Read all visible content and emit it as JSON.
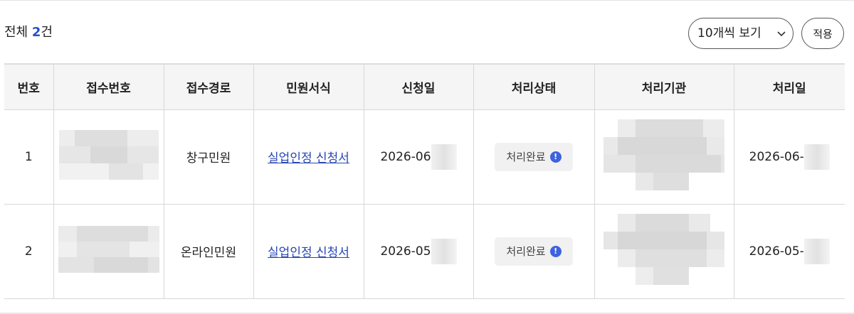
{
  "summary": {
    "prefix": "전체",
    "count": "2",
    "suffix": "건"
  },
  "controls": {
    "page_size_label": "10개씩 보기",
    "apply_label": "적용"
  },
  "table": {
    "headers": [
      "번호",
      "접수번호",
      "접수경로",
      "민원서식",
      "신청일",
      "처리상태",
      "처리기관",
      "처리일"
    ],
    "rows": [
      {
        "no": "1",
        "route": "창구민원",
        "form": "실업인정 신청서",
        "applied": "2026-06",
        "status": "처리완료",
        "processed": "2026-06-"
      },
      {
        "no": "2",
        "route": "온라인민원",
        "form": "실업인정 신청서",
        "applied": "2026-05",
        "status": "처리완료",
        "processed": "2026-05-"
      }
    ]
  },
  "colors": {
    "accent": "#2552c9",
    "link": "#2746b5",
    "info_icon": "#3d63e0"
  },
  "icons": {
    "select": "chevron-down-icon",
    "status": "info-icon"
  }
}
